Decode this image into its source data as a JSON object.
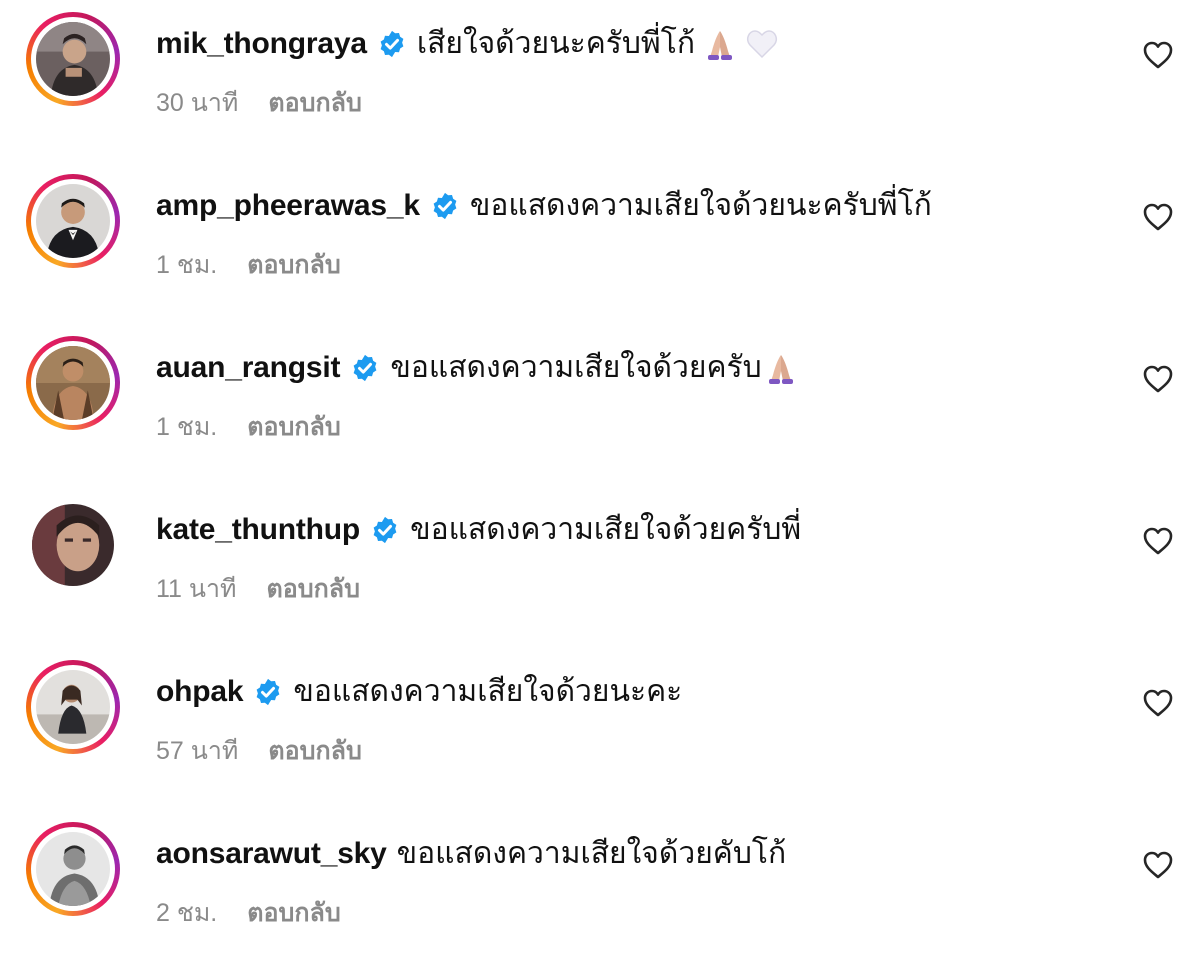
{
  "comments": [
    {
      "username": "mik_thongraya",
      "verified": true,
      "text": "เสียใจด้วยนะครับพี่โก้",
      "emojis": [
        "folded-hands-emoji",
        "white-heart-emoji"
      ],
      "time": "30 นาที",
      "reply_label": "ตอบกลับ",
      "avatar_ring": true
    },
    {
      "username": "amp_pheerawas_k",
      "verified": true,
      "text": "ขอแสดงความเสียใจด้วยนะครับพี่โก้",
      "emojis": [],
      "time": "1 ชม.",
      "reply_label": "ตอบกลับ",
      "avatar_ring": true
    },
    {
      "username": "auan_rangsit",
      "verified": true,
      "text": "ขอแสดงความเสียใจด้วยครับ",
      "emojis": [
        "folded-hands-emoji"
      ],
      "time": "1 ชม.",
      "reply_label": "ตอบกลับ",
      "avatar_ring": true
    },
    {
      "username": "kate_thunthup",
      "verified": true,
      "text": "ขอแสดงความเสียใจด้วยครับพี่",
      "emojis": [],
      "time": "11 นาที",
      "reply_label": "ตอบกลับ",
      "avatar_ring": false
    },
    {
      "username": "ohpak",
      "verified": true,
      "text": "ขอแสดงความเสียใจด้วยนะคะ",
      "emojis": [],
      "time": "57 นาที",
      "reply_label": "ตอบกลับ",
      "avatar_ring": true
    },
    {
      "username": "aonsarawut_sky",
      "verified": false,
      "text": "ขอแสดงความเสียใจด้วยคับโก้",
      "emojis": [],
      "time": "2 ชม.",
      "reply_label": "ตอบกลับ",
      "avatar_ring": true
    }
  ],
  "colors": {
    "verified_badge": "#1d9bf0",
    "meta_text": "#8a8a8a",
    "primary_text": "#111111",
    "heart_outline": "#262626"
  },
  "icons": {
    "verified": "verified-badge-icon",
    "like": "heart-outline-icon"
  }
}
